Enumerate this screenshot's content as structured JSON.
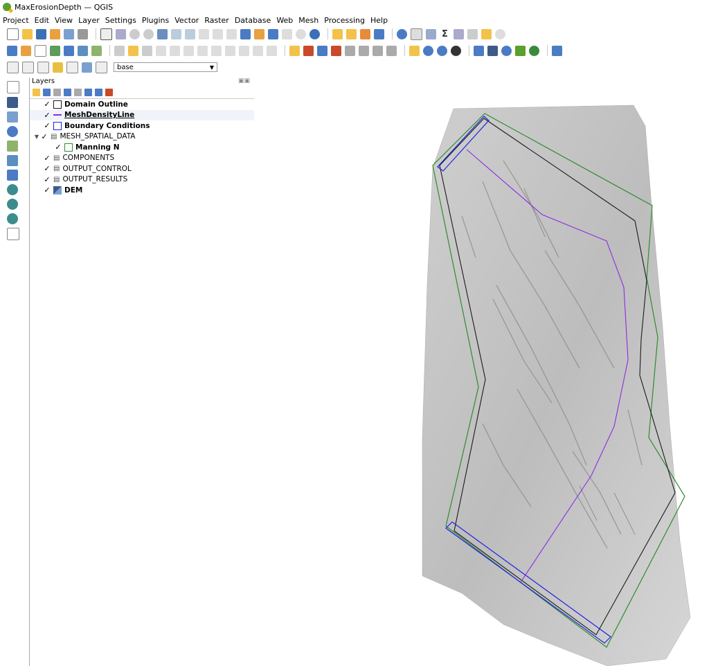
{
  "window": {
    "title": "MaxErosionDepth — QGIS"
  },
  "menu": [
    "Project",
    "Edit",
    "View",
    "Layer",
    "Settings",
    "Plugins",
    "Vector",
    "Raster",
    "Database",
    "Web",
    "Mesh",
    "Processing",
    "Help"
  ],
  "digitize": {
    "combo_value": "base"
  },
  "layers_panel": {
    "title": "Layers",
    "layers": [
      {
        "name": "Domain Outline",
        "checked": true
      },
      {
        "name": "MeshDensityLine",
        "checked": true
      },
      {
        "name": "Boundary Conditions",
        "checked": true
      },
      {
        "name": "MESH_SPATIAL_DATA",
        "checked": true,
        "expanded": true
      },
      {
        "name": "Manning N",
        "checked": true
      },
      {
        "name": "COMPONENTS",
        "checked": true
      },
      {
        "name": "OUTPUT_CONTROL",
        "checked": true
      },
      {
        "name": "OUTPUT_RESULTS",
        "checked": true
      },
      {
        "name": "DEM",
        "checked": true
      }
    ]
  },
  "colors": {
    "domain_outline": "#1a1a1a",
    "mesh_density_line": "#8a2be2",
    "boundary_conditions": "#1e22e0",
    "manning_n": "#2e8b2e",
    "dem_hillshade": "#bdbdbd"
  },
  "icons": {
    "left_toolbar": [
      "add-vector-layer-icon",
      "add-raster-layer-icon",
      "add-mesh-layer-icon",
      "add-delimited-text-icon",
      "add-spatialite-icon",
      "add-virtual-layer-icon",
      "add-postgis-icon",
      "add-wms-icon",
      "add-wcs-icon",
      "add-wfs-icon",
      "new-layer-icon"
    ]
  }
}
